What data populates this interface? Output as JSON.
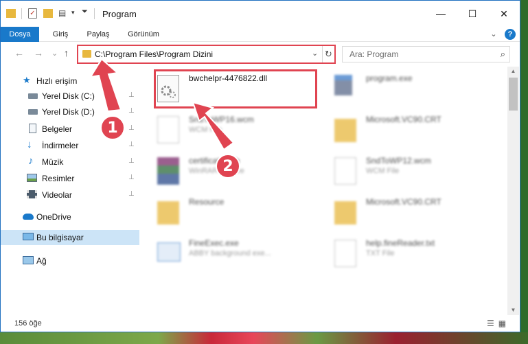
{
  "window": {
    "title": "Program",
    "controls": {
      "minimize": "—",
      "maximize": "☐",
      "close": "✕"
    }
  },
  "ribbon": {
    "tabs": [
      {
        "label": "Dosya",
        "active": true
      },
      {
        "label": "Giriş",
        "active": false
      },
      {
        "label": "Paylaş",
        "active": false
      },
      {
        "label": "Görünüm",
        "active": false
      }
    ],
    "expand_icon": "⌄",
    "help_icon": "?"
  },
  "nav": {
    "back": "←",
    "forward": "→",
    "recent": "⌄",
    "up": "↑",
    "address": "C:\\Program Files\\Program Dizini",
    "address_dropdown": "⌄",
    "refresh": "↻",
    "search_placeholder": "Ara: Program",
    "search_icon": "⌕"
  },
  "sidebar": {
    "items": [
      {
        "label": "Hızlı erişim",
        "icon": "star-icon",
        "pinned": false,
        "selected": false
      },
      {
        "label": "Yerel Disk (C:)",
        "icon": "drive-icon",
        "pinned": true,
        "selected": false
      },
      {
        "label": "Yerel Disk (D:)",
        "icon": "drive-icon",
        "pinned": true,
        "selected": false
      },
      {
        "label": "Belgeler",
        "icon": "document-icon",
        "pinned": true,
        "selected": false
      },
      {
        "label": "İndirmeler",
        "icon": "download-icon",
        "pinned": true,
        "selected": false
      },
      {
        "label": "Müzik",
        "icon": "music-icon",
        "pinned": true,
        "selected": false
      },
      {
        "label": "Resimler",
        "icon": "pictures-icon",
        "pinned": true,
        "selected": false
      },
      {
        "label": "Videolar",
        "icon": "video-icon",
        "pinned": true,
        "selected": false
      },
      {
        "label": "OneDrive",
        "icon": "cloud-icon",
        "pinned": false,
        "selected": false
      },
      {
        "label": "Bu bilgisayar",
        "icon": "computer-icon",
        "pinned": false,
        "selected": true
      },
      {
        "label": "Ağ",
        "icon": "network-icon",
        "pinned": false,
        "selected": false
      }
    ],
    "pin_glyph": "📌"
  },
  "files": [
    {
      "name": "bwchelpr-4476822.dll",
      "type": "",
      "icon": "dll-gear-icon",
      "highlighted": true
    },
    {
      "name": "program.exe",
      "type": "",
      "icon": "exe-icon",
      "highlighted": false
    },
    {
      "name": "SndToWP16.wcm",
      "type": "WCM File",
      "icon": "file-icon",
      "highlighted": false
    },
    {
      "name": "Microsoft.VC90.CRT",
      "type": "",
      "icon": "folder-icon",
      "highlighted": false
    },
    {
      "name": "certificate.cab",
      "type": "WinRAR archive",
      "icon": "archive-icon",
      "highlighted": false
    },
    {
      "name": "SndToWP12.wcm",
      "type": "WCM File",
      "icon": "file-icon",
      "highlighted": false
    },
    {
      "name": "Resource",
      "type": "",
      "icon": "folder-icon",
      "highlighted": false
    },
    {
      "name": "Microsoft.VC90.CRT",
      "type": "",
      "icon": "folder-icon",
      "highlighted": false
    },
    {
      "name": "FineExec.exe",
      "type": "ABBY background exe...",
      "icon": "exe-icon",
      "highlighted": false
    },
    {
      "name": "help.fineReader.txt",
      "type": "TXT File",
      "icon": "text-file-icon",
      "highlighted": false
    }
  ],
  "status": {
    "count": "156 öğe",
    "view_icons": "☰▦"
  },
  "annotations": {
    "step1": "1",
    "step2": "2",
    "accent": "#e04451"
  },
  "colors": {
    "ribbon_active": "#1979ca",
    "selection": "#cce4f7",
    "folder": "#e8b83e"
  }
}
